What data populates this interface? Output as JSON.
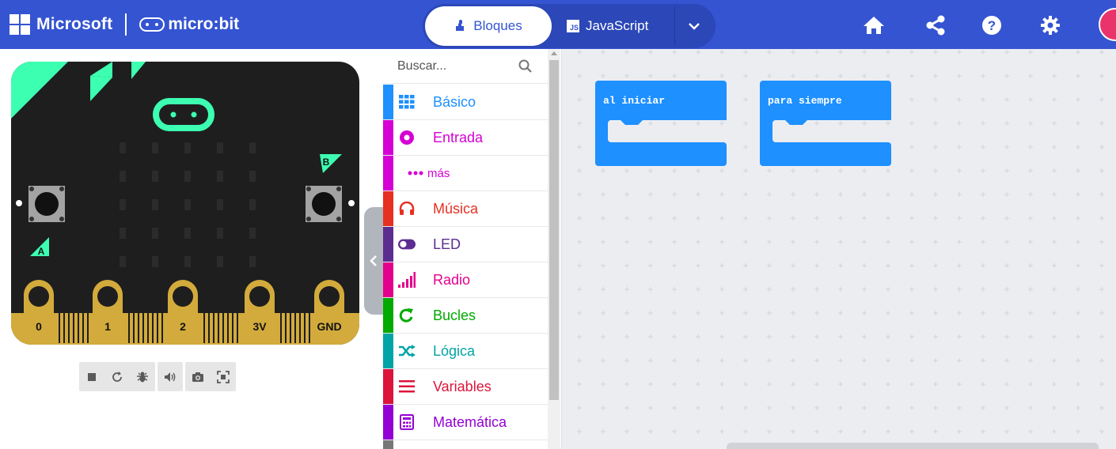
{
  "header": {
    "microsoft_label": "Microsoft",
    "microbit_label": "micro:bit",
    "tab_blocks": "Bloques",
    "tab_js": "JavaScript",
    "js_badge": "JS",
    "accent": "#3454d1",
    "icons": [
      "home-icon",
      "share-icon",
      "help-icon",
      "settings-icon",
      "avatar"
    ]
  },
  "simulator": {
    "pin_labels": [
      "0",
      "1",
      "2",
      "3V",
      "GND"
    ],
    "button_a": "A",
    "button_b": "B",
    "board_color": "#1e1e1e",
    "accent_color": "#3dffb1",
    "pin_color": "#d3ab3c",
    "toolbar": [
      "stop-icon",
      "restart-icon",
      "debug-icon",
      "sound-icon",
      "screenshot-icon",
      "fullscreen-icon"
    ]
  },
  "toolbox": {
    "search_placeholder": "Buscar...",
    "categories": [
      {
        "label": "Básico",
        "color": "#1e90ff",
        "icon": "grid-icon"
      },
      {
        "label": "Entrada",
        "color": "#d400d4",
        "icon": "input-icon"
      },
      {
        "label": "más",
        "color": "#d400d4",
        "icon": "more-icon"
      },
      {
        "label": "Música",
        "color": "#e63022",
        "icon": "headphones-icon"
      },
      {
        "label": "LED",
        "color": "#5c2d91",
        "icon": "toggle-icon"
      },
      {
        "label": "Radio",
        "color": "#e3008c",
        "icon": "signal-icon"
      },
      {
        "label": "Bucles",
        "color": "#00aa00",
        "icon": "loop-icon"
      },
      {
        "label": "Lógica",
        "color": "#00a4a6",
        "icon": "shuffle-icon"
      },
      {
        "label": "Variables",
        "color": "#dc143c",
        "icon": "list-icon"
      },
      {
        "label": "Matemática",
        "color": "#9400d3",
        "icon": "calculator-icon"
      }
    ]
  },
  "workspace": {
    "blocks": [
      {
        "label": "al iniciar"
      },
      {
        "label": "para siempre"
      }
    ],
    "block_color": "#1e90ff"
  }
}
